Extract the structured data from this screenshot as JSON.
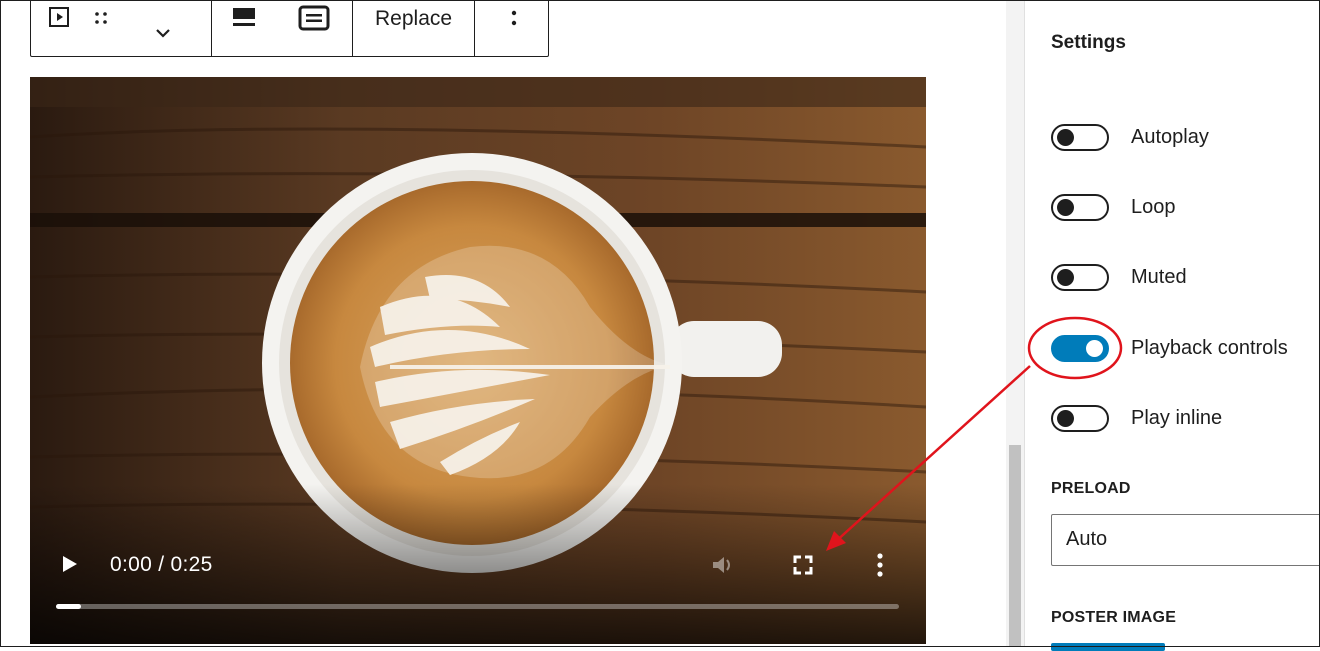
{
  "toolbar": {
    "replace_label": "Replace",
    "icons": [
      "video-block-icon",
      "drag-handle-icon",
      "chevron-down-icon",
      "align-wide-icon",
      "align-full-icon",
      "more-options-icon"
    ]
  },
  "video": {
    "time_text": "0:00 / 0:25",
    "progress_fraction": 0.03,
    "icons": [
      "play-icon",
      "volume-icon",
      "fullscreen-icon",
      "more-vertical-icon"
    ]
  },
  "settings": {
    "title": "Settings",
    "toggles": [
      {
        "label": "Autoplay",
        "on": false
      },
      {
        "label": "Loop",
        "on": false
      },
      {
        "label": "Muted",
        "on": false
      },
      {
        "label": "Playback controls",
        "on": true
      },
      {
        "label": "Play inline",
        "on": false
      }
    ],
    "preload": {
      "label": "PRELOAD",
      "value": "Auto"
    },
    "poster": {
      "label": "POSTER IMAGE"
    }
  },
  "colors": {
    "accent": "#007cba",
    "annotation": "#e0141c",
    "text": "#1e1e1e"
  }
}
